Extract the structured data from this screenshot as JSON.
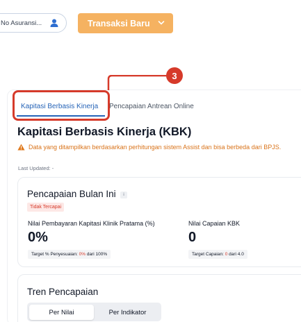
{
  "toolbar": {
    "search_placeholder": "No Asuransi...",
    "new_transaction_label": "Transaksi Baru"
  },
  "annotation": {
    "step_number": "3"
  },
  "tabs": [
    {
      "label": "Kapitasi Berbasis Kinerja",
      "active": true
    },
    {
      "label": "Pencapaian Antrean Online",
      "active": false
    }
  ],
  "page": {
    "title": "Kapitasi Berbasis Kinerja (KBK)",
    "warning": "Data yang ditampilkan berdasarkan perhitungan sistem Assist dan bisa berbeda dari BPJS.",
    "last_updated": "Last Updated: -"
  },
  "achievement": {
    "title": "Pencapaian Bulan Ini",
    "info_icon_text": "i",
    "status_badge": "Tidak Tercapai",
    "metrics": [
      {
        "label": "Nilai Pembayaran Kapitasi Klinik Pratama (%)",
        "value": "0%",
        "target_prefix": "Target % Penyesuaian: ",
        "target_current": "0%",
        "target_suffix": " dari 100%"
      },
      {
        "label": "Nilai Capaian KBK",
        "value": "0",
        "target_prefix": "Target Capaian: ",
        "target_current": "0",
        "target_suffix": " dari 4.0"
      }
    ]
  },
  "trend": {
    "title": "Tren Pencapaian",
    "toggle": [
      {
        "label": "Per Nilai",
        "active": true
      },
      {
        "label": "Per Indikator",
        "active": false
      }
    ]
  },
  "colors": {
    "accent_orange": "#f5b261",
    "annotation_red": "#d63a2a",
    "tab_blue": "#2563b7",
    "warning_orange": "#d9731a"
  },
  "icons": [
    "user-icon",
    "chevron-down-icon",
    "warning-icon",
    "info-icon"
  ]
}
